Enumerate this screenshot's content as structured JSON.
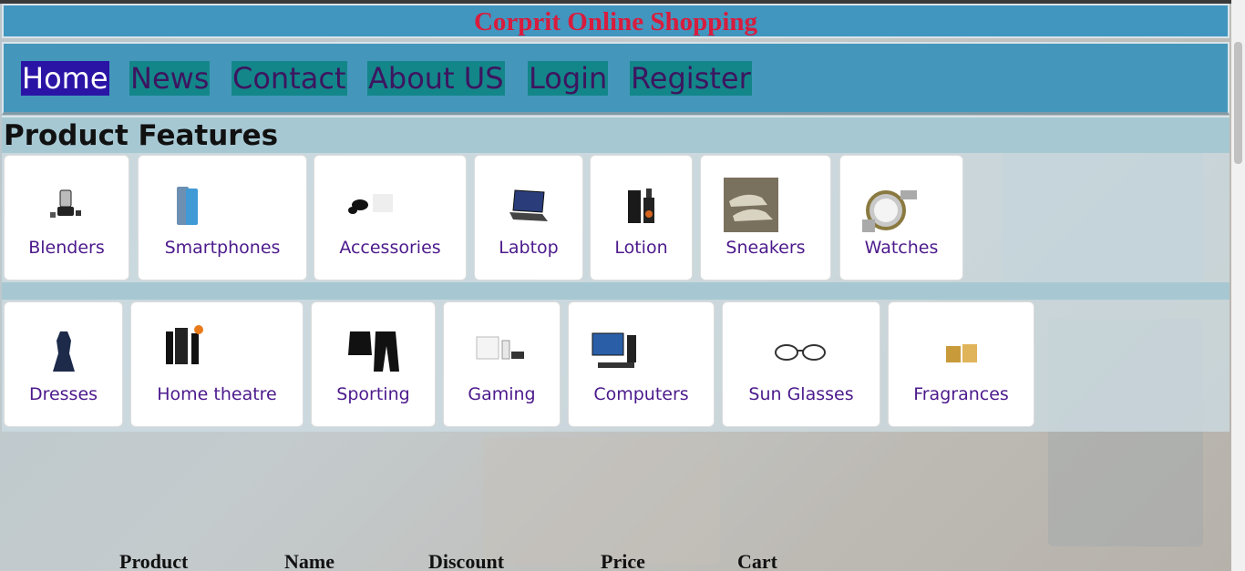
{
  "site": {
    "title": "Corprit Online Shopping"
  },
  "nav": {
    "items": [
      {
        "label": "Home",
        "active": true
      },
      {
        "label": "News"
      },
      {
        "label": "Contact"
      },
      {
        "label": "About US"
      },
      {
        "label": "Login"
      },
      {
        "label": "Register"
      }
    ]
  },
  "features": {
    "heading": "Product Features",
    "row1": [
      {
        "label": "Blenders",
        "icon": "blender-icon"
      },
      {
        "label": "Smartphones",
        "icon": "smartphone-icon"
      },
      {
        "label": "Accessories",
        "icon": "earbuds-icon"
      },
      {
        "label": "Labtop",
        "icon": "laptop-icon"
      },
      {
        "label": "Lotion",
        "icon": "lotion-icon"
      },
      {
        "label": "Sneakers",
        "icon": "sneakers-icon"
      },
      {
        "label": "Watches",
        "icon": "watch-icon"
      }
    ],
    "row2": [
      {
        "label": "Dresses",
        "icon": "dress-icon"
      },
      {
        "label": "Home theatre",
        "icon": "speaker-icon"
      },
      {
        "label": "Sporting",
        "icon": "tracksuit-icon"
      },
      {
        "label": "Gaming",
        "icon": "console-icon"
      },
      {
        "label": "Computers",
        "icon": "computer-icon"
      },
      {
        "label": "Sun Glasses",
        "icon": "glasses-icon"
      },
      {
        "label": "Fragrances",
        "icon": "fragrance-icon"
      }
    ]
  },
  "table": {
    "headers": [
      "Product",
      "Name",
      "Discount",
      "Price",
      "Cart"
    ]
  },
  "colors": {
    "title": "#d81c3d",
    "nav_bg": "#4497bb",
    "nav_item_bg": "#138689",
    "nav_active_bg": "#2a14a6",
    "card_label": "#4c1a8c"
  }
}
